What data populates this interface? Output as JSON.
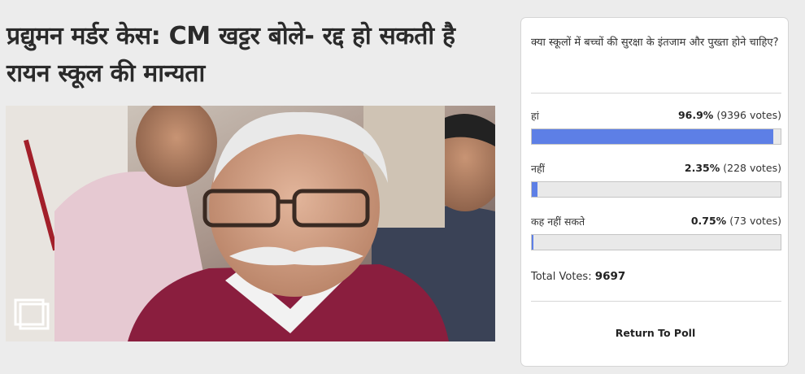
{
  "article": {
    "headline": "प्रद्युमन मर्डर केस: CM खट्टर बोले- रद्द हो सकती है रायन स्कूल की मान्यता"
  },
  "poll": {
    "question": "क्या स्कूलों में बच्चों की सुरक्षा के इंतजाम और पुख्ता होने चाहिए?",
    "options": [
      {
        "label": "हां",
        "percent": "96.9%",
        "votes": "(9396 votes)",
        "fraction": 0.969
      },
      {
        "label": "नहीं",
        "percent": "2.35%",
        "votes": "(228 votes)",
        "fraction": 0.0235
      },
      {
        "label": "कह नहीं सकते",
        "percent": "0.75%",
        "votes": "(73 votes)",
        "fraction": 0.0075
      }
    ],
    "total_label": "Total Votes:",
    "total_value": "9697",
    "return_label": "Return To Poll",
    "bar_color": "#5d7fe6"
  },
  "icons": {
    "gallery": "gallery-icon"
  }
}
